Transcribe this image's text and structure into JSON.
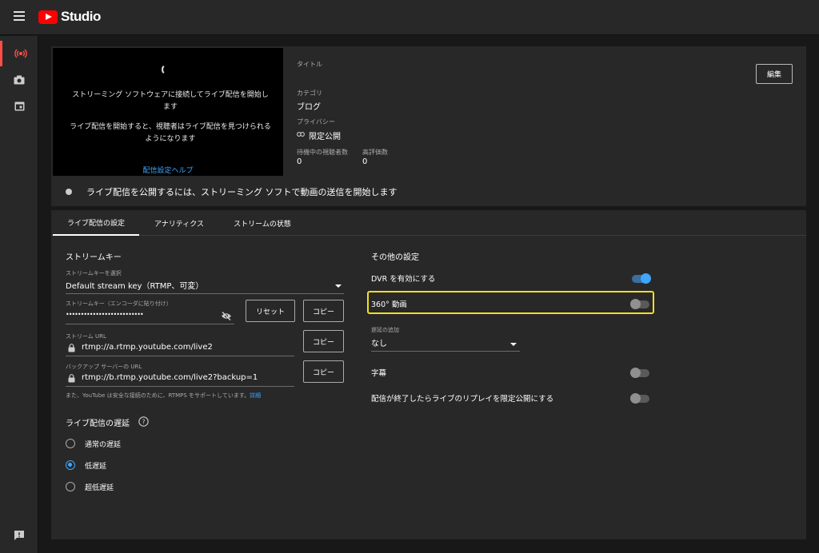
{
  "app": {
    "name": "Studio"
  },
  "sidebar": {
    "items": [
      {
        "icon": "live-broadcast-icon",
        "active": true
      },
      {
        "icon": "camera-icon",
        "active": false
      },
      {
        "icon": "calendar-icon",
        "active": false
      }
    ],
    "feedback_icon": "feedback-icon"
  },
  "preview": {
    "line1": "ストリーミング ソフトウェアに接続してライブ配信を開始します",
    "line2": "ライブ配信を開始すると、視聴者はライブ配信を見つけられるようになります",
    "help_link": "配信設定ヘルプ"
  },
  "details": {
    "title_label": "タイトル",
    "category_label": "カテゴリ",
    "category_value": "ブログ",
    "privacy_label": "プライバシー",
    "privacy_value": "限定公開",
    "viewers_label": "待機中の視聴者数",
    "viewers_value": "0",
    "likes_label": "高評価数",
    "likes_value": "0",
    "edit_button": "編集"
  },
  "status": {
    "text": "ライブ配信を公開するには、ストリーミング ソフトで動画の送信を開始します"
  },
  "tabs": [
    {
      "label": "ライブ配信の設定",
      "active": true
    },
    {
      "label": "アナリティクス",
      "active": false
    },
    {
      "label": "ストリームの状態",
      "active": false
    }
  ],
  "stream_key": {
    "section_title": "ストリームキー",
    "select_label": "ストリームキーを選択",
    "select_value": "Default stream key（RTMP、可変）",
    "key_label": "ストリームキー（エンコーダに貼り付け）",
    "key_value": "••••••••••••••••••••••••••",
    "reset_button": "リセット",
    "copy_button": "コピー",
    "url_label": "ストリーム URL",
    "url_value": "rtmp://a.rtmp.youtube.com/live2",
    "backup_label": "バックアップ サーバーの URL",
    "backup_value": "rtmp://b.rtmp.youtube.com/live2?backup=1",
    "note": "また、YouTube は安全な接続のために、RTMPS をサポートしています。",
    "note_link": "詳細"
  },
  "latency": {
    "title": "ライブ配信の遅延",
    "options": [
      {
        "label": "通常の遅延",
        "selected": false
      },
      {
        "label": "低遅延",
        "selected": true
      },
      {
        "label": "超低遅延",
        "selected": false
      }
    ]
  },
  "other_settings": {
    "title": "その他の設定",
    "dvr_label": "DVR を有効にする",
    "dvr_on": true,
    "video360_label": "360° 動画",
    "video360_on": false,
    "delay_label": "遅延の追加",
    "delay_value": "なし",
    "captions_label": "字幕",
    "captions_on": false,
    "replay_label": "配信が終了したらライブのリプレイを限定公開にする",
    "replay_on": false
  },
  "colors": {
    "accent": "#3ea6ff",
    "brand": "#ff0000",
    "highlight": "#f2e01e",
    "live": "#ff4e45"
  }
}
